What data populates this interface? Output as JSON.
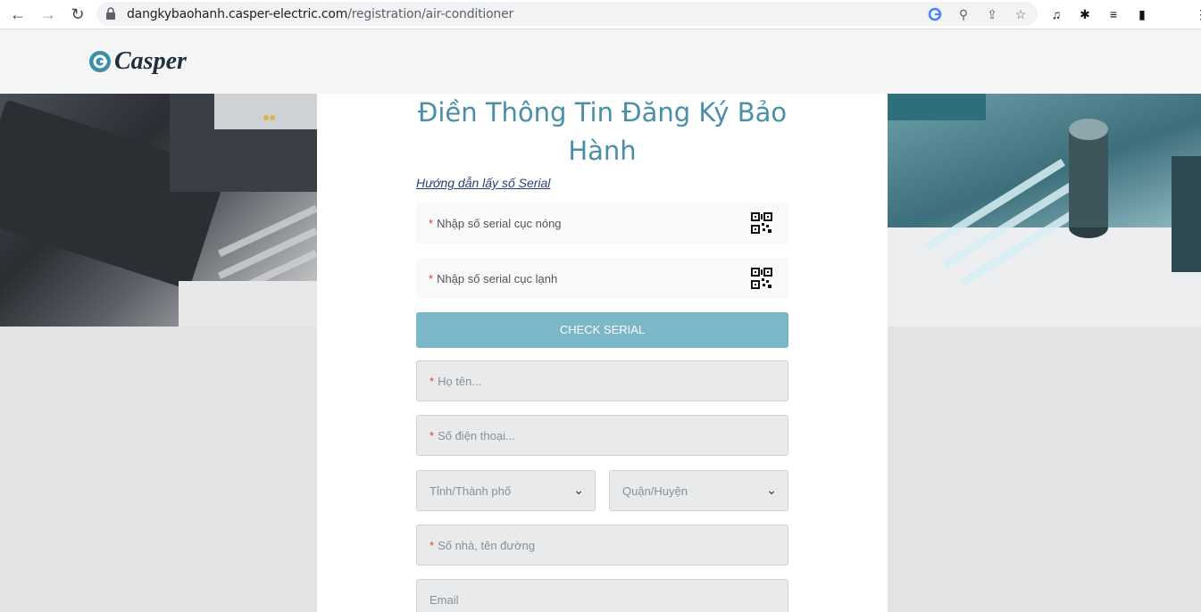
{
  "browser": {
    "url_host": "dangkybaohanh.casper-electric.com",
    "url_path": "/registration/air-conditioner"
  },
  "site": {
    "logo_text": "Casper"
  },
  "form": {
    "title_line1": "Điền Thông Tin Đăng Ký Bảo",
    "title_line2": "Hành",
    "guide_link": "Hướng dẫn lấy số Serial",
    "required_mark": "*",
    "serial_hot_placeholder": "Nhập số serial cục nóng",
    "serial_cold_placeholder": "Nhập số serial cục lạnh",
    "check_button": "CHECK SERIAL",
    "name_placeholder": "Họ tên...",
    "phone_placeholder": "Số điện thoại...",
    "province_placeholder": "Tỉnh/Thành phố",
    "district_placeholder": "Quận/Huyện",
    "address_placeholder": "Số nhà, tên đường",
    "email_placeholder": "Email"
  },
  "colors": {
    "title": "#4a8fa7",
    "button": "#7ab7c9",
    "required": "#e53935"
  }
}
